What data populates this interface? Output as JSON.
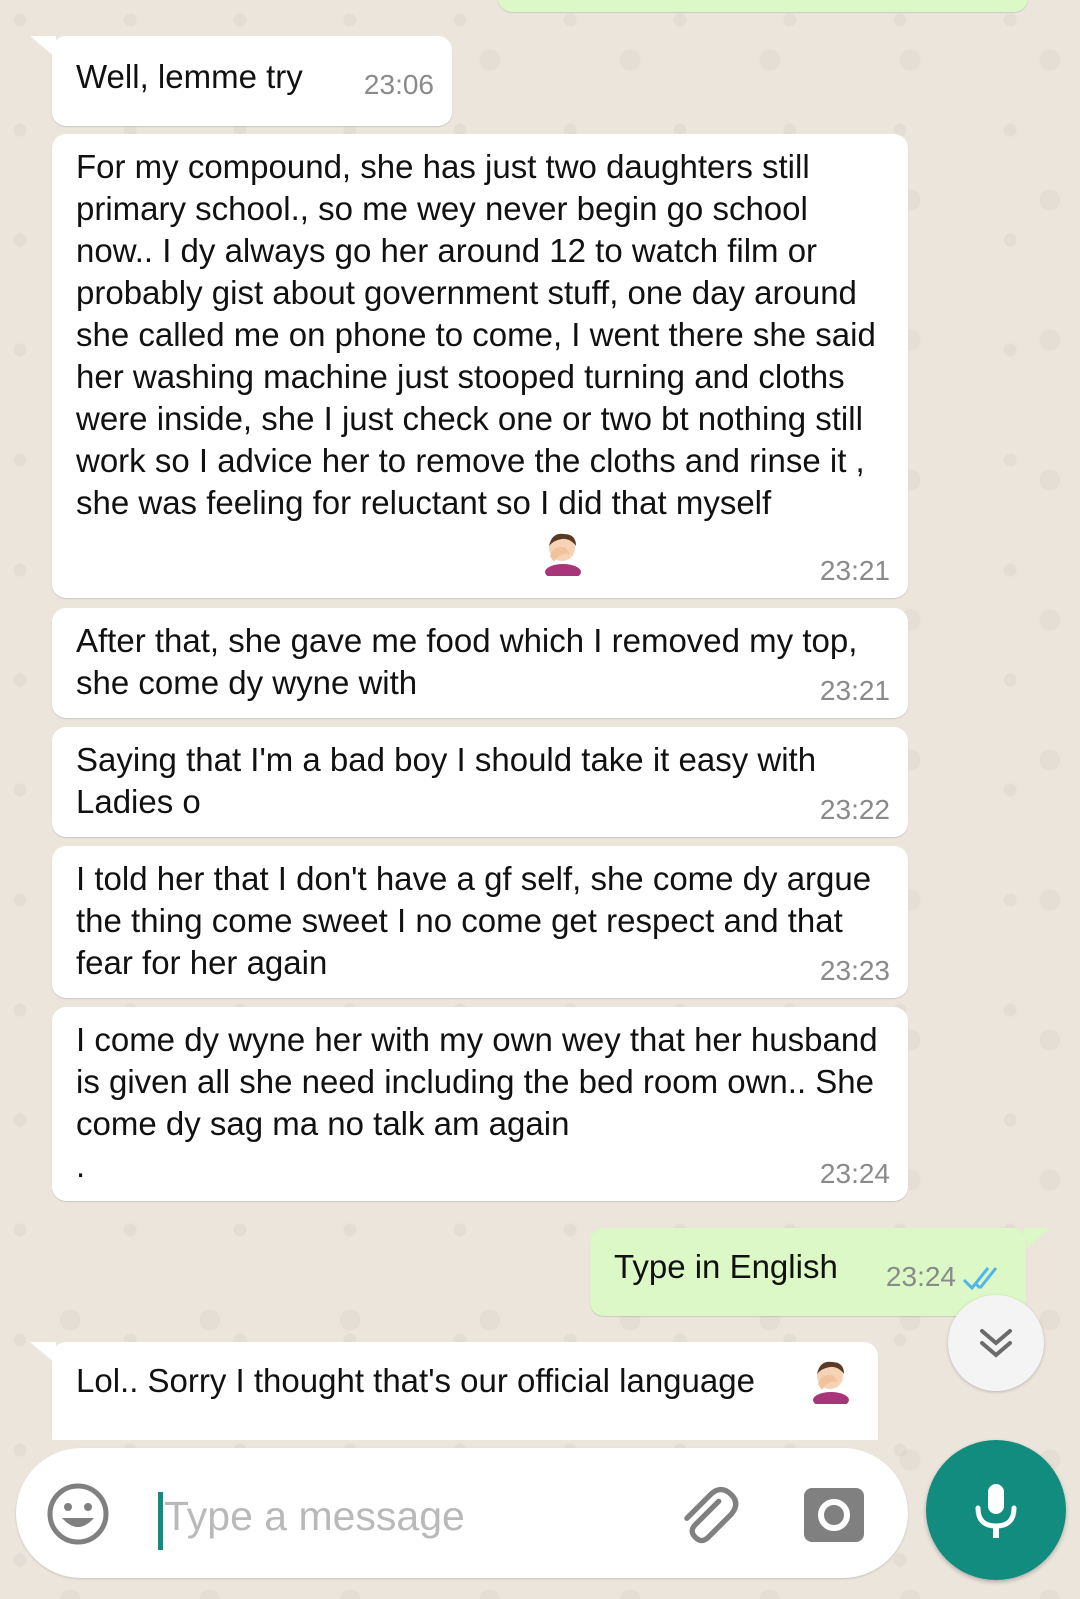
{
  "messages": [
    {
      "text": "Well, lemme try",
      "time": "23:06"
    },
    {
      "text": "For my compound, she has just two daughters still primary school., so me wey never begin go school now.. I dy always go her around 12 to watch film or probably gist about government stuff, one day around she called me on phone to come, I went there she said  her washing machine just stooped turning and cloths were inside, she I just check one or two bt nothing still work so I advice her to remove the cloths and rinse it , she was feeling for reluctant so I did that myself",
      "time": "23:21"
    },
    {
      "text": "After that, she gave me food which I removed my top, she come dy wyne with",
      "time": "23:21"
    },
    {
      "text": "Saying that I'm a bad boy I should take it easy with Ladies o",
      "time": "23:22"
    },
    {
      "text": "I told her that I don't have a gf self, she come dy argue the thing come sweet I no come get respect and that fear for her again",
      "time": "23:23"
    },
    {
      "text": "I come dy wyne her with my own wey that her husband is given all she need including the bed room own.. She come dy sag ma no talk am again\n.",
      "time": "23:24"
    },
    {
      "text": "Type in English",
      "time": "23:24",
      "status": "read"
    },
    {
      "text": "Lol.. Sorry I thought that's our official language"
    }
  ],
  "composer": {
    "placeholder": "Type a message",
    "icons": [
      "emoji-icon",
      "attach-icon",
      "camera-icon",
      "mic-icon"
    ]
  },
  "scroll_down_icon": "double-chevron-down-icon",
  "colors": {
    "incoming": "#ffffff",
    "outgoing": "#dcf8c6",
    "accent": "#128c7e",
    "read_ticks": "#4fb6ec"
  }
}
